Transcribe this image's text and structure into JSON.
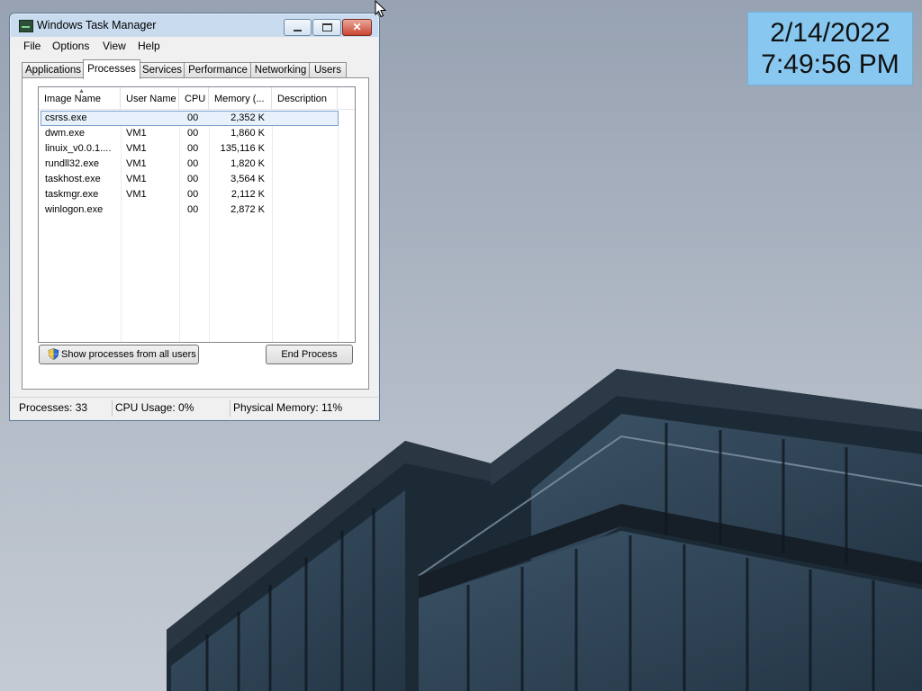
{
  "clock": {
    "date": "2/14/2022",
    "time": "7:49:56 PM"
  },
  "window": {
    "title": "Windows Task Manager",
    "buttons": {
      "minimize": "minimize",
      "maximize": "maximize",
      "close": "✕"
    }
  },
  "menu": [
    "File",
    "Options",
    "View",
    "Help"
  ],
  "tabs": [
    "Applications",
    "Processes",
    "Services",
    "Performance",
    "Networking",
    "Users"
  ],
  "active_tab": "Processes",
  "columns": [
    "Image Name",
    "User Name",
    "CPU",
    "Memory (...",
    "Description"
  ],
  "rows": [
    {
      "image": "csrss.exe",
      "user": "",
      "cpu": "00",
      "memory": "2,352 K",
      "desc": ""
    },
    {
      "image": "dwm.exe",
      "user": "VM1",
      "cpu": "00",
      "memory": "1,860 K",
      "desc": ""
    },
    {
      "image": "linuix_v0.0.1....",
      "user": "VM1",
      "cpu": "00",
      "memory": "135,116 K",
      "desc": ""
    },
    {
      "image": "rundll32.exe",
      "user": "VM1",
      "cpu": "00",
      "memory": "1,820 K",
      "desc": ""
    },
    {
      "image": "taskhost.exe",
      "user": "VM1",
      "cpu": "00",
      "memory": "3,564 K",
      "desc": ""
    },
    {
      "image": "taskmgr.exe",
      "user": "VM1",
      "cpu": "00",
      "memory": "2,112 K",
      "desc": ""
    },
    {
      "image": "winlogon.exe",
      "user": "",
      "cpu": "00",
      "memory": "2,872 K",
      "desc": ""
    }
  ],
  "selected_row": 0,
  "buttons": {
    "show_all": "Show processes from all users",
    "end_process": "End Process"
  },
  "status": {
    "processes": "Processes: 33",
    "cpu": "CPU Usage: 0%",
    "memory": "Physical Memory: 11%"
  },
  "colors": {
    "clock_bg": "#88c8f0",
    "selection": "#e8f1fb",
    "close_button": "#c9452f"
  }
}
